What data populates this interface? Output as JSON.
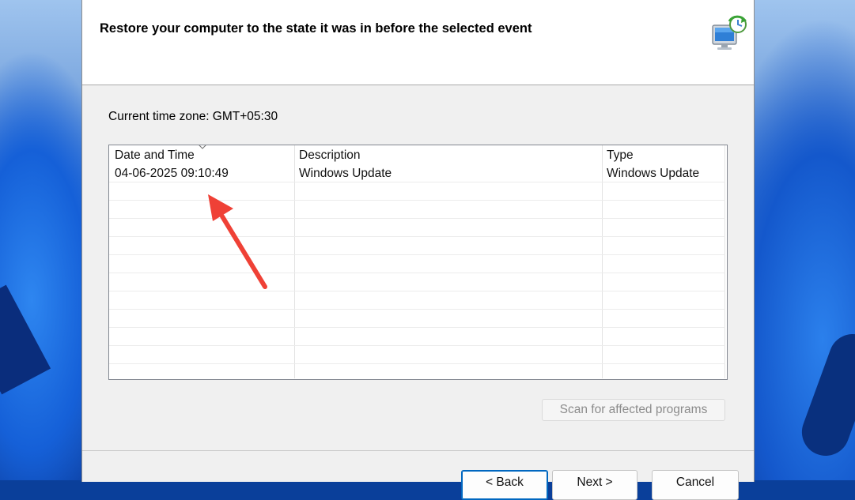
{
  "dialog": {
    "header_title": "Restore your computer to the state it was in before the selected event",
    "timezone_label": "Current time zone: GMT+05:30"
  },
  "restore_points": {
    "columns": [
      "Date and Time",
      "Description",
      "Type"
    ],
    "sorted_column": "Date and Time",
    "rows": [
      {
        "date_time": "04-06-2025 09:10:49",
        "description": "Windows Update",
        "type": "Windows Update"
      }
    ]
  },
  "buttons": {
    "scan_label": "Scan for affected programs",
    "back_label": "< Back",
    "next_label": "Next >",
    "cancel_label": "Cancel"
  },
  "colors": {
    "annotation_arrow": "#ef4136",
    "accent": "#0067c0",
    "dialog_bg": "#f0f0f0"
  },
  "icons": {
    "header": "system-restore-icon",
    "sort": "sort-descending-icon"
  }
}
